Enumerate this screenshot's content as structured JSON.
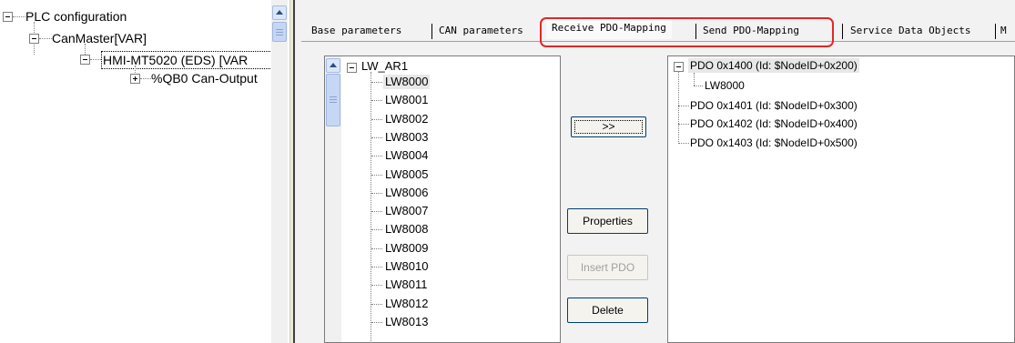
{
  "tree": {
    "nodes": [
      {
        "label": "PLC configuration",
        "expander": "minus"
      },
      {
        "label": "CanMaster[VAR]",
        "expander": "minus"
      },
      {
        "label": "HMI-MT5020 (EDS)  [VAR",
        "expander": "minus"
      },
      {
        "label": "%QB0 Can-Output",
        "expander": "plus"
      }
    ]
  },
  "tabs": [
    {
      "label": "Base parameters"
    },
    {
      "label": "CAN parameters"
    },
    {
      "label": "Receive PDO-Mapping"
    },
    {
      "label": "Send PDO-Mapping"
    },
    {
      "label": "Service Data Objects"
    },
    {
      "label": "M"
    }
  ],
  "active_tab": "Receive PDO-Mapping",
  "highlight_color": "#e32626",
  "objects_list": {
    "root": "LW_AR1",
    "items": [
      "LW8000",
      "LW8001",
      "LW8002",
      "LW8003",
      "LW8004",
      "LW8005",
      "LW8006",
      "LW8007",
      "LW8008",
      "LW8009",
      "LW8010",
      "LW8011",
      "LW8012",
      "LW8013"
    ],
    "selected": "LW8000"
  },
  "buttons": {
    "add": ">>",
    "properties": "Properties",
    "insert_pdo": "Insert PDO",
    "delete": "Delete"
  },
  "pdo_list": {
    "items": [
      {
        "label": "PDO 0x1400 (Id: $NodeID+0x200)",
        "expander": "minus"
      },
      {
        "label": "LW8000",
        "child": true
      },
      {
        "label": "PDO 0x1401 (Id: $NodeID+0x300)"
      },
      {
        "label": "PDO 0x1402 (Id: $NodeID+0x400)"
      },
      {
        "label": "PDO 0x1403 (Id: $NodeID+0x500)"
      }
    ]
  }
}
